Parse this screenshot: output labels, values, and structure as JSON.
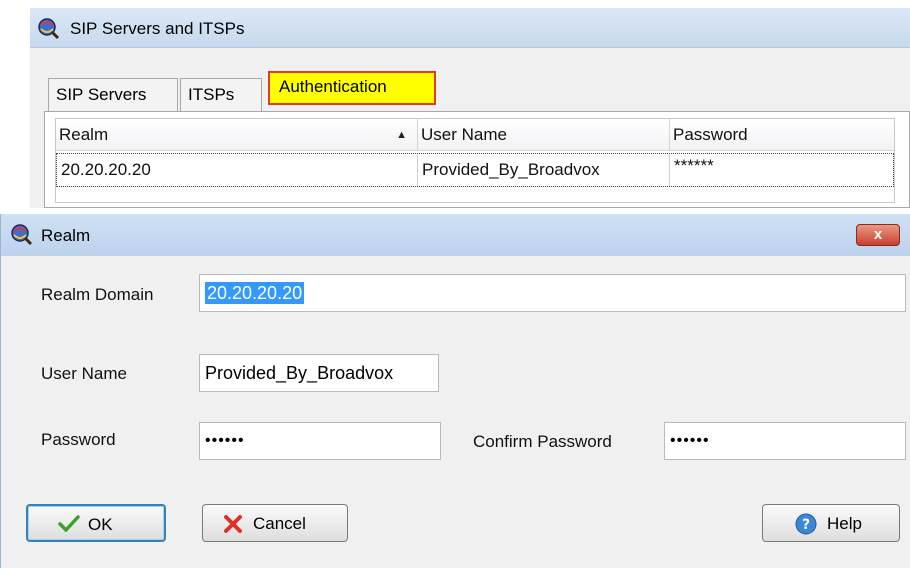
{
  "top_window": {
    "title": "SIP Servers and ITSPs",
    "tabs": [
      {
        "label": "SIP Servers"
      },
      {
        "label": "ITSPs"
      },
      {
        "label": "Authentication"
      }
    ],
    "grid": {
      "columns": [
        "Realm",
        "User Name",
        "Password"
      ],
      "sort_indicator": "▲",
      "rows": [
        {
          "realm": "20.20.20.20",
          "user_name": "Provided_By_Broadvox",
          "password": "******"
        }
      ]
    }
  },
  "realm_dialog": {
    "title": "Realm",
    "close_symbol": "x",
    "realm_domain": {
      "label": "Realm Domain",
      "value": "20.20.20.20"
    },
    "user_name": {
      "label": "User Name",
      "value": "Provided_By_Broadvox"
    },
    "password": {
      "label": "Password",
      "value": "••••••"
    },
    "confirm_password": {
      "label": "Confirm Password",
      "value": "••••••"
    },
    "buttons": {
      "ok": "OK",
      "cancel": "Cancel",
      "help": "Help"
    }
  },
  "colors": {
    "active_tab_fill": "#ffff00",
    "active_tab_border": "#e8362a",
    "titlebar": "#c7d9ee",
    "selection": "#3399ff"
  },
  "icons": {
    "app": "magnifier-over-globe-icon",
    "ok": "checkmark-icon",
    "cancel": "red-x-icon",
    "help": "question-circle-icon"
  }
}
